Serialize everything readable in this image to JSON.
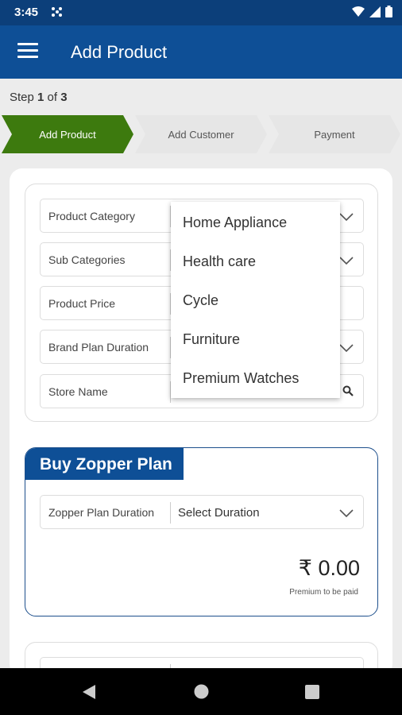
{
  "status_bar": {
    "time": "3:45"
  },
  "app_bar": {
    "title": "Add Product"
  },
  "step_indicator": {
    "prefix": "Step",
    "current": "1",
    "of": "of",
    "total": "3"
  },
  "stepper": {
    "steps": [
      {
        "label": "Add Product",
        "active": true
      },
      {
        "label": "Add Customer",
        "active": false
      },
      {
        "label": "Payment",
        "active": false
      }
    ],
    "active_color": "#3d7a0e",
    "inactive_color": "#e6e6e6"
  },
  "form": {
    "product_category_label": "Product Category",
    "sub_categories_label": "Sub Categories",
    "product_price_label": "Product Price",
    "brand_plan_duration_label": "Brand Plan Duration",
    "store_name_label": "Store Name"
  },
  "category_dropdown": {
    "options": [
      "Home Appliance",
      "Health care",
      "Cycle",
      "Furniture",
      "Premium Watches"
    ]
  },
  "zopper_plan": {
    "title": "Buy Zopper Plan",
    "duration_label": "Zopper Plan Duration",
    "duration_value": "Select Duration",
    "amount": "₹ 0.00",
    "amount_caption": "Premium to be paid"
  },
  "colors": {
    "primary": "#0e4f96",
    "status_bar": "#0c3f7a",
    "accent_green": "#3d7a0e"
  }
}
